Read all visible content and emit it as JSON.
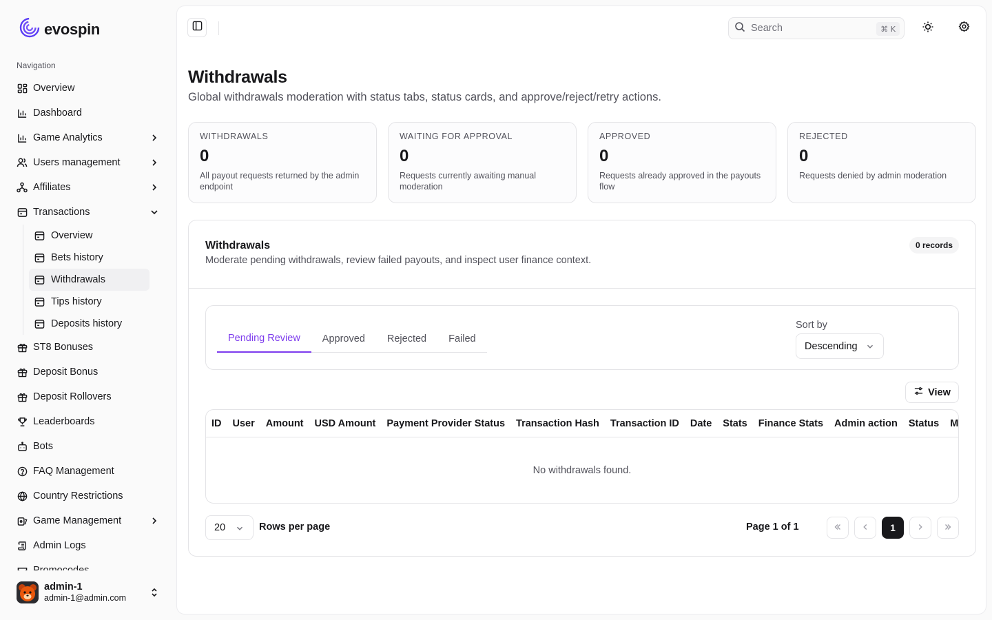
{
  "brand": {
    "name": "evospin"
  },
  "nav": {
    "section_title": "Navigation",
    "items": [
      {
        "label": "Overview"
      },
      {
        "label": "Dashboard"
      },
      {
        "label": "Game Analytics"
      },
      {
        "label": "Users management"
      },
      {
        "label": "Affiliates"
      },
      {
        "label": "Transactions"
      },
      {
        "label": "ST8 Bonuses"
      },
      {
        "label": "Deposit Bonus"
      },
      {
        "label": "Deposit Rollovers"
      },
      {
        "label": "Leaderboards"
      },
      {
        "label": "Bots"
      },
      {
        "label": "FAQ Management"
      },
      {
        "label": "Country Restrictions"
      },
      {
        "label": "Game Management"
      },
      {
        "label": "Admin Logs"
      },
      {
        "label": "Promocodes"
      }
    ],
    "transactions_sub": [
      {
        "label": "Overview"
      },
      {
        "label": "Bets history"
      },
      {
        "label": "Withdrawals"
      },
      {
        "label": "Tips history"
      },
      {
        "label": "Deposits history"
      }
    ]
  },
  "user": {
    "name": "admin-1",
    "email": "admin-1@admin.com"
  },
  "topbar": {
    "search_placeholder": "Search",
    "shortcut": "⌘ K"
  },
  "page": {
    "title": "Withdrawals",
    "subtitle": "Global withdrawals moderation with status tabs, status cards, and approve/reject/retry actions."
  },
  "cards": [
    {
      "label": "WITHDRAWALS",
      "value": "0",
      "desc": "All payout requests returned by the admin endpoint"
    },
    {
      "label": "WAITING FOR APPROVAL",
      "value": "0",
      "desc": "Requests currently awaiting manual moderation"
    },
    {
      "label": "APPROVED",
      "value": "0",
      "desc": "Requests already approved in the payouts flow"
    },
    {
      "label": "REJECTED",
      "value": "0",
      "desc": "Requests denied by admin moderation"
    }
  ],
  "panel": {
    "title": "Withdrawals",
    "subtitle": "Moderate pending withdrawals, review failed payouts, and inspect user finance context.",
    "records": "0 records",
    "tabs": [
      "Pending Review",
      "Approved",
      "Rejected",
      "Failed"
    ],
    "sort_label": "Sort by",
    "sort_value": "Descending",
    "view_label": "View",
    "columns": [
      "ID",
      "User",
      "Amount",
      "USD Amount",
      "Payment Provider Status",
      "Transaction Hash",
      "Transaction ID",
      "Date",
      "Stats",
      "Finance Stats",
      "Admin action",
      "Status",
      "More info"
    ],
    "empty_text": "No withdrawals found.",
    "rows_per_page_value": "20",
    "rows_per_page_label": "Rows per page",
    "page_info": "Page 1 of 1",
    "current_page": "1"
  },
  "colors": {
    "accent": "#7c3aed",
    "text": "#18181b",
    "muted": "#52525b",
    "border": "#e4e4e7"
  }
}
